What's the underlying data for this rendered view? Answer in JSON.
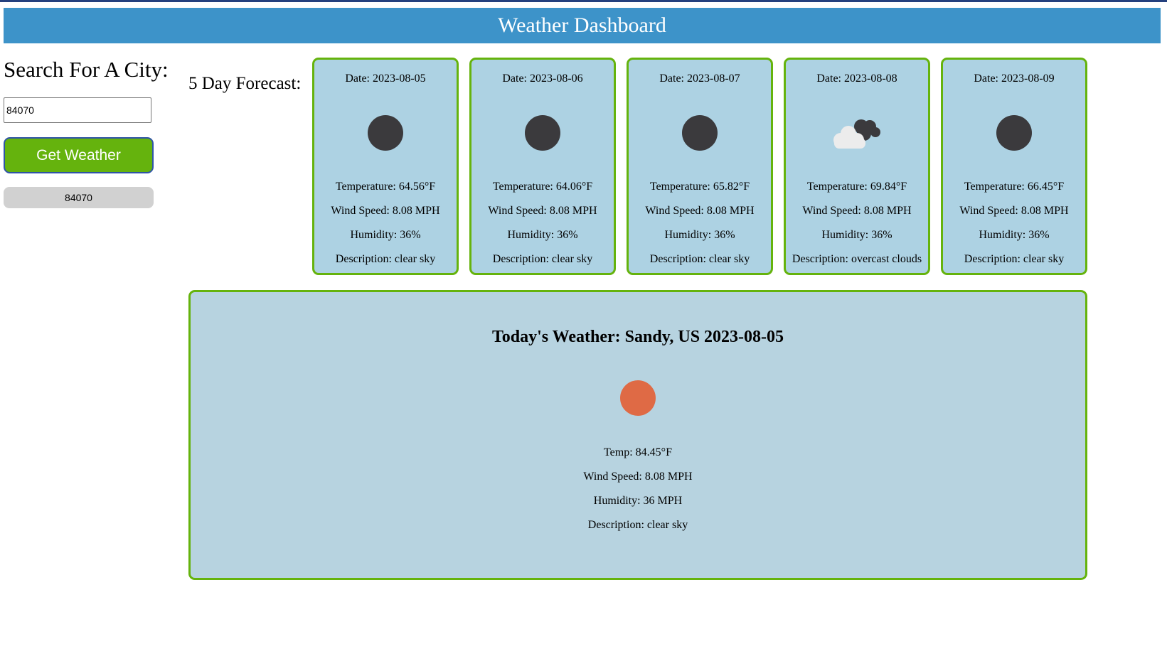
{
  "header": {
    "title": "Weather Dashboard"
  },
  "search": {
    "title": "Search For A City:",
    "input_value": "84070",
    "button_label": "Get Weather",
    "history": [
      "84070"
    ]
  },
  "forecast": {
    "label": "5 Day Forecast:",
    "days": [
      {
        "date": "Date: 2023-08-05",
        "icon": "clear-sky-icon",
        "temp": "Temperature: 64.56°F",
        "wind": "Wind Speed: 8.08 MPH",
        "humidity": "Humidity: 36%",
        "description": "Description: clear sky"
      },
      {
        "date": "Date: 2023-08-06",
        "icon": "clear-sky-icon",
        "temp": "Temperature: 64.06°F",
        "wind": "Wind Speed: 8.08 MPH",
        "humidity": "Humidity: 36%",
        "description": "Description: clear sky"
      },
      {
        "date": "Date: 2023-08-07",
        "icon": "clear-sky-icon",
        "temp": "Temperature: 65.82°F",
        "wind": "Wind Speed: 8.08 MPH",
        "humidity": "Humidity: 36%",
        "description": "Description: clear sky"
      },
      {
        "date": "Date: 2023-08-08",
        "icon": "overcast-clouds-icon",
        "temp": "Temperature: 69.84°F",
        "wind": "Wind Speed: 8.08 MPH",
        "humidity": "Humidity: 36%",
        "description": "Description: overcast clouds"
      },
      {
        "date": "Date: 2023-08-09",
        "icon": "clear-sky-icon",
        "temp": "Temperature: 66.45°F",
        "wind": "Wind Speed: 8.08 MPH",
        "humidity": "Humidity: 36%",
        "description": "Description: clear sky"
      }
    ]
  },
  "today": {
    "title": "Today's Weather: Sandy, US 2023-08-05",
    "icon": "sun-icon",
    "temp": "Temp: 84.45°F",
    "wind": "Wind Speed: 8.08 MPH",
    "humidity": "Humidity: 36 MPH",
    "description": "Description: clear sky"
  },
  "colors": {
    "header_bg": "#3d93c9",
    "button_green": "#65b30d",
    "card_bg": "#add2e3",
    "today_bg": "#b7d3e0",
    "sun": "#df6a45",
    "night_dot": "#3b3a3d"
  }
}
